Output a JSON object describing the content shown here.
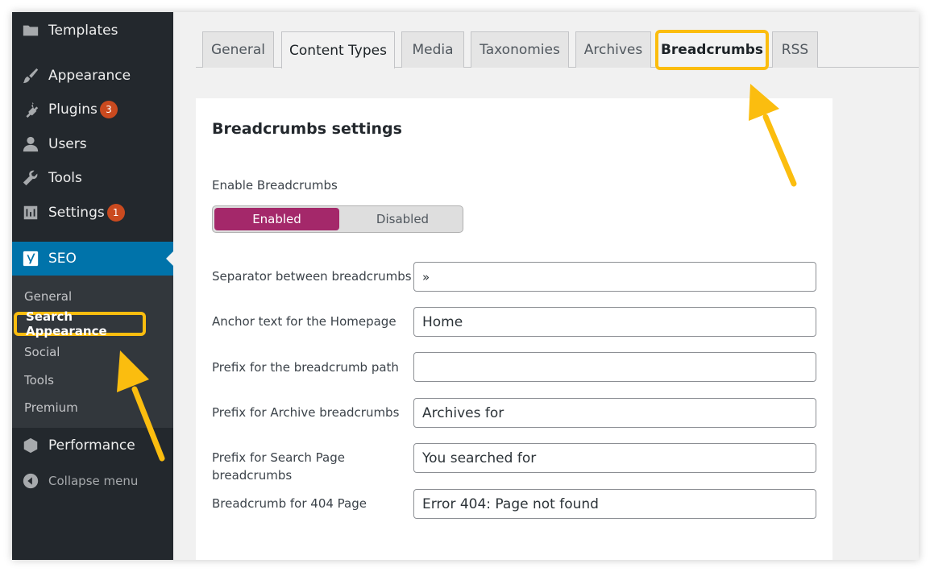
{
  "sidebar": {
    "items": [
      {
        "label": "Templates",
        "icon": "folder-icon"
      },
      {
        "label": "Appearance",
        "icon": "paintbrush-icon"
      },
      {
        "label": "Plugins",
        "icon": "plugin-icon",
        "badge": "3"
      },
      {
        "label": "Users",
        "icon": "user-icon"
      },
      {
        "label": "Tools",
        "icon": "wrench-icon"
      },
      {
        "label": "Settings",
        "icon": "settings-icon",
        "badge": "1"
      },
      {
        "label": "SEO",
        "icon": "yoast-icon"
      },
      {
        "label": "Performance",
        "icon": "performance-icon"
      },
      {
        "label": "Collapse menu",
        "icon": "collapse-icon"
      }
    ],
    "submenu": [
      "General",
      "Search Appearance",
      "Social",
      "Tools",
      "Premium"
    ]
  },
  "tabs": [
    "General",
    "Content Types",
    "Media",
    "Taxonomies",
    "Archives",
    "Breadcrumbs",
    "RSS"
  ],
  "panel": {
    "title": "Breadcrumbs settings",
    "enable_label": "Enable Breadcrumbs",
    "toggle_on": "Enabled",
    "toggle_off": "Disabled",
    "fields": [
      {
        "label": "Separator between breadcrumbs",
        "value": "»"
      },
      {
        "label": "Anchor text for the Homepage",
        "value": "Home"
      },
      {
        "label": "Prefix for the breadcrumb path",
        "value": ""
      },
      {
        "label": "Prefix for Archive breadcrumbs",
        "value": "Archives for"
      },
      {
        "label": "Prefix for Search Page breadcrumbs",
        "value": "You searched for"
      },
      {
        "label": "Breadcrumb for 404 Page",
        "value": "Error 404: Page not found"
      }
    ]
  },
  "colors": {
    "sidebar_bg": "#23282d",
    "active_menu": "#0073aa",
    "badge": "#ca4a1f",
    "toggle_active": "#a4286a",
    "highlight": "#fbbd0f"
  }
}
